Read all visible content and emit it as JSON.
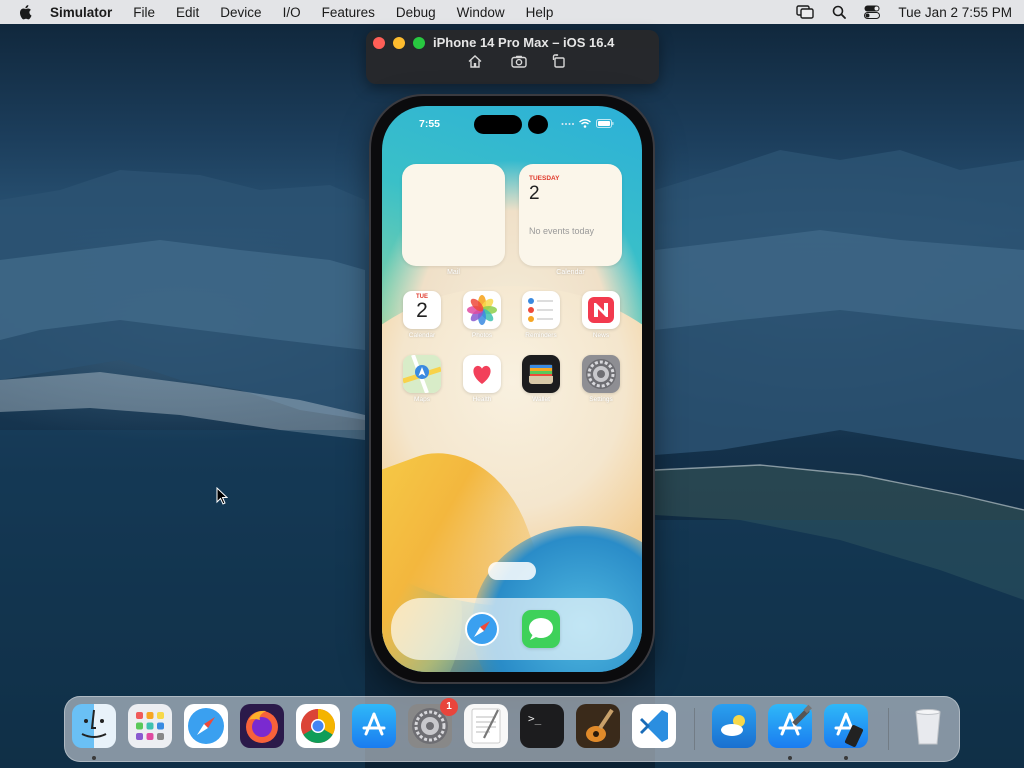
{
  "menubar": {
    "app_name": "Simulator",
    "items": [
      "File",
      "Edit",
      "Device",
      "I/O",
      "Features",
      "Debug",
      "Window",
      "Help"
    ],
    "clock": "Tue Jan 2  7:55 PM"
  },
  "simulator": {
    "title": "iPhone 14 Pro Max – iOS 16.4"
  },
  "phone": {
    "status_time": "7:55",
    "widgets": {
      "mail_label": "Mail",
      "calendar_label": "Calendar",
      "calendar_day": "TUESDAY",
      "calendar_date": "2",
      "calendar_events": "No events today"
    },
    "apps": [
      {
        "label": "Calendar",
        "icon": "calendar-icon",
        "day": "TUE",
        "date": "2"
      },
      {
        "label": "Photos",
        "icon": "photos-icon"
      },
      {
        "label": "Reminders",
        "icon": "reminders-icon"
      },
      {
        "label": "News",
        "icon": "news-icon"
      },
      {
        "label": "Maps",
        "icon": "maps-icon"
      },
      {
        "label": "Health",
        "icon": "health-icon"
      },
      {
        "label": "Wallet",
        "icon": "wallet-icon"
      },
      {
        "label": "Settings",
        "icon": "settings-icon"
      }
    ],
    "dock": [
      "safari-icon",
      "messages-icon"
    ]
  },
  "dock": {
    "system_settings_badge": "1",
    "terminal_prompt": ">_"
  },
  "colors": {
    "menubar_bg": "#ececee",
    "close": "#ff5f57",
    "minimize": "#febc2e",
    "zoom": "#28c840"
  }
}
